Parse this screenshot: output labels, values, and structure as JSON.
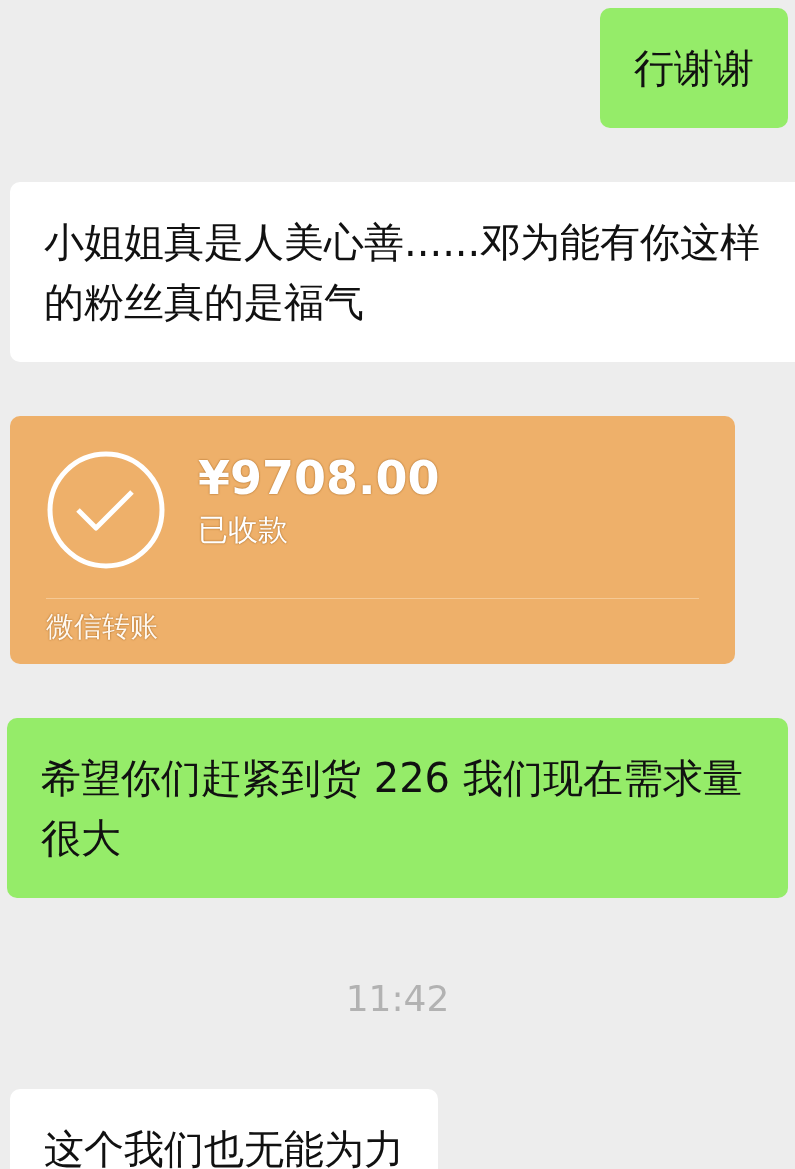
{
  "messages": [
    {
      "kind": "text",
      "outgoing": true,
      "text": "行谢谢"
    },
    {
      "kind": "text",
      "outgoing": false,
      "text": "小姐姐真是人美心善......邓为能有你这样的粉丝真的是福气"
    },
    {
      "kind": "transfer",
      "outgoing": false,
      "amount": "¥9708.00",
      "status": "已收款",
      "label": "微信转账"
    },
    {
      "kind": "text",
      "outgoing": true,
      "text": "希望你们赶紧到货 226 我们现在需求量很大"
    },
    {
      "kind": "time",
      "text": "11:42"
    },
    {
      "kind": "text",
      "outgoing": false,
      "text": "这个我们也无能为力"
    }
  ]
}
